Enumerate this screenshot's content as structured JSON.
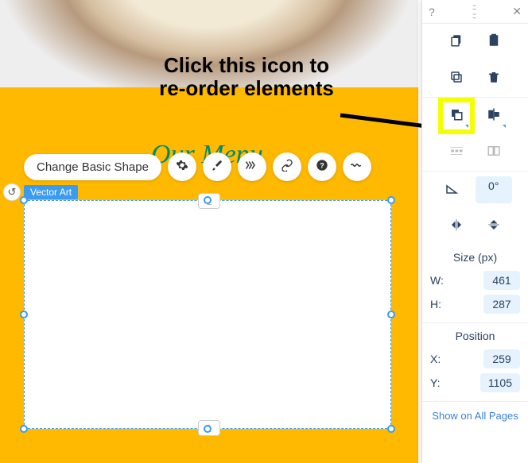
{
  "annotation": {
    "line1": "Click this icon to",
    "line2": "re-order elements"
  },
  "canvas": {
    "decorative_title": "Our Menu",
    "selection_label": "Vector Art"
  },
  "floating_toolbar": {
    "change_shape_label": "Change Basic Shape"
  },
  "panel": {
    "rotation_value": "0°",
    "size_title": "Size (px)",
    "width_label": "W:",
    "width_value": "461",
    "height_label": "H:",
    "height_value": "287",
    "position_title": "Position",
    "x_label": "X:",
    "x_value": "259",
    "y_label": "Y:",
    "y_value": "1105",
    "show_all_label": "Show on All Pages"
  }
}
